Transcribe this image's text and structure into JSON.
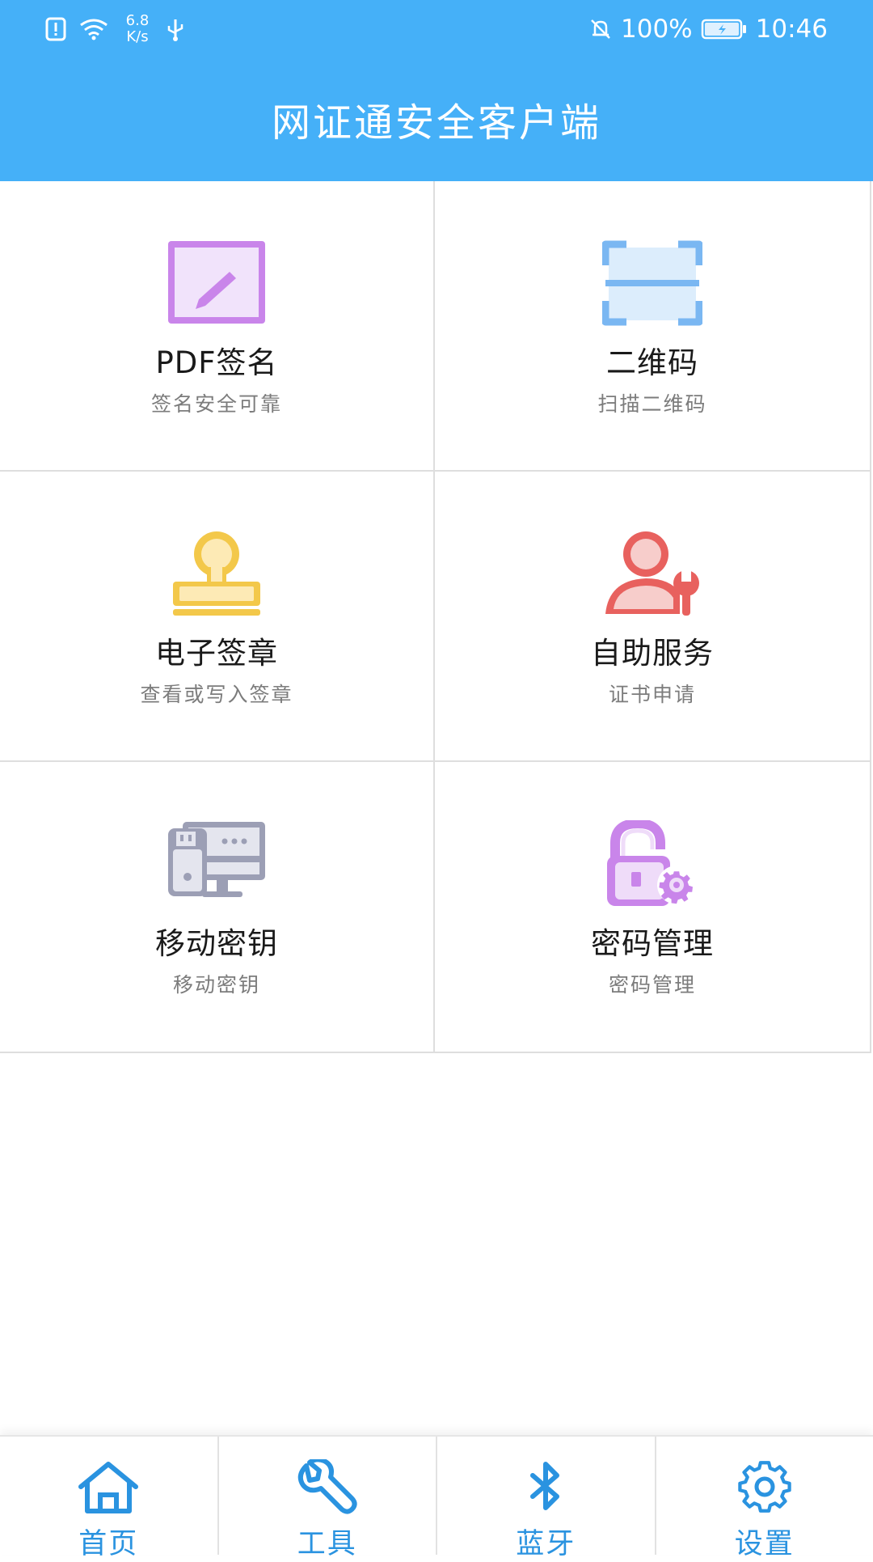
{
  "status_bar": {
    "net_speed_value": "6.8",
    "net_speed_unit": "K/s",
    "battery": "100%",
    "time": "10:46"
  },
  "header": {
    "title": "网证通安全客户端"
  },
  "tiles": [
    {
      "title": "PDF签名",
      "subtitle": "签名安全可靠",
      "icon": "pdf-sign-icon"
    },
    {
      "title": "二维码",
      "subtitle": "扫描二维码",
      "icon": "qr-scan-icon"
    },
    {
      "title": "电子签章",
      "subtitle": "查看或写入签章",
      "icon": "stamp-icon"
    },
    {
      "title": "自助服务",
      "subtitle": "证书申请",
      "icon": "user-wrench-icon"
    },
    {
      "title": "移动密钥",
      "subtitle": "移动密钥",
      "icon": "usb-key-icon"
    },
    {
      "title": "密码管理",
      "subtitle": "密码管理",
      "icon": "lock-gear-icon"
    }
  ],
  "bottom_nav": [
    {
      "label": "首页",
      "icon": "home-icon"
    },
    {
      "label": "工具",
      "icon": "wrench-icon"
    },
    {
      "label": "蓝牙",
      "icon": "bluetooth-icon"
    },
    {
      "label": "设置",
      "icon": "gear-icon"
    }
  ],
  "colors": {
    "header_bg": "#45b0f8",
    "nav_accent": "#2a93e0"
  }
}
